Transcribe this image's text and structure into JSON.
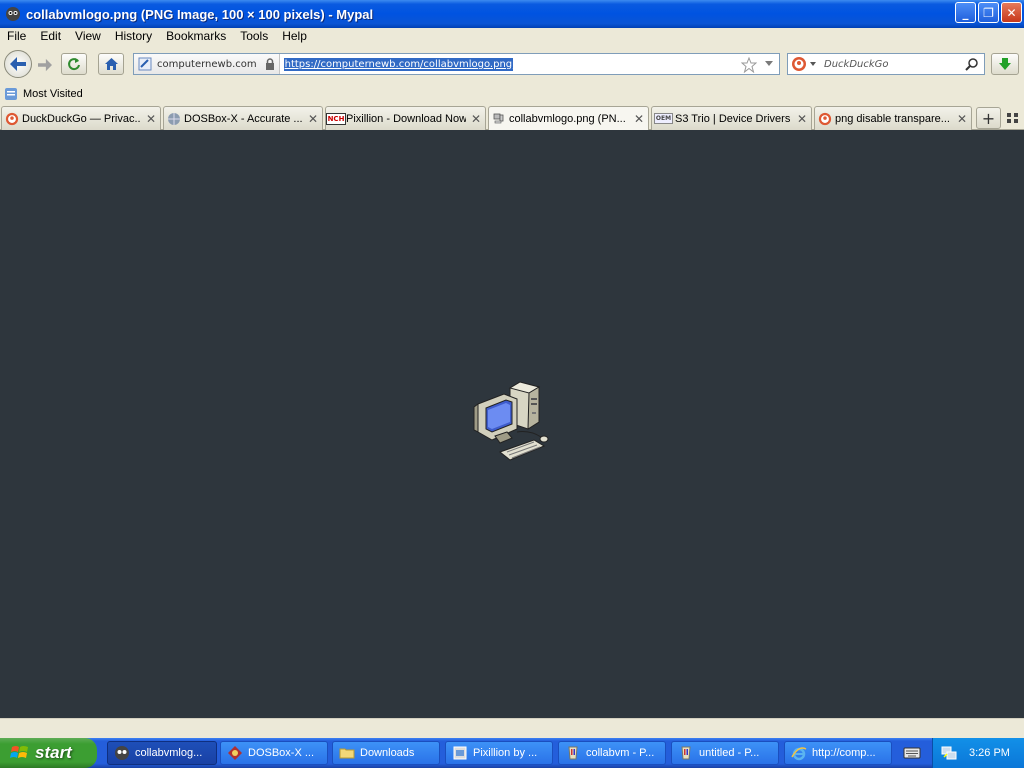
{
  "window": {
    "title": "collabvmlogo.png (PNG Image, 100 × 100 pixels) - Mypal",
    "buttons": {
      "minimize": "_",
      "maximize": "❐",
      "close": "✕"
    }
  },
  "menu": [
    "File",
    "Edit",
    "View",
    "History",
    "Bookmarks",
    "Tools",
    "Help"
  ],
  "nav": {
    "identity_host": "computernewb.com",
    "url": "https://computernewb.com/collabvmlogo.png",
    "search_placeholder": "DuckDuckGo"
  },
  "bookmarks": {
    "most_visited": "Most Visited"
  },
  "tabs": [
    {
      "label": "DuckDuckGo — Privac...",
      "icon": "duckduckgo-icon"
    },
    {
      "label": "DOSBox-X - Accurate ...",
      "icon": "globe-icon"
    },
    {
      "label": "Pixillion - Download Now",
      "icon": "nch-icon"
    },
    {
      "label": "collabvmlogo.png (PN...",
      "icon": "image-icon",
      "active": true
    },
    {
      "label": "S3 Trio | Device Drivers",
      "icon": "oem-icon"
    },
    {
      "label": "png disable transpare...",
      "icon": "duckduckgo-icon"
    }
  ],
  "oem_icon_text": "OEM",
  "nch_icon_text": "NCH",
  "new_tab_label": "+",
  "content": {
    "image_alt": "collabvm computer logo"
  },
  "taskbar": {
    "start": "start",
    "tasks": [
      {
        "label": "collabvmlog...",
        "icon": "mypal-icon",
        "active": true
      },
      {
        "label": "DOSBox-X ...",
        "icon": "dosbox-icon"
      },
      {
        "label": "Downloads",
        "icon": "folder-icon"
      },
      {
        "label": "Pixillion by ...",
        "icon": "pixillion-icon"
      },
      {
        "label": "collabvm - P...",
        "icon": "paint-icon"
      },
      {
        "label": "untitled - P...",
        "icon": "paint-icon"
      },
      {
        "label": "http://comp...",
        "icon": "ie-icon"
      }
    ],
    "clock": "3:26 PM"
  },
  "colors": {
    "content_bg": "#2e363d",
    "title_blue": "#0053e1",
    "start_green": "#3c9e32"
  }
}
